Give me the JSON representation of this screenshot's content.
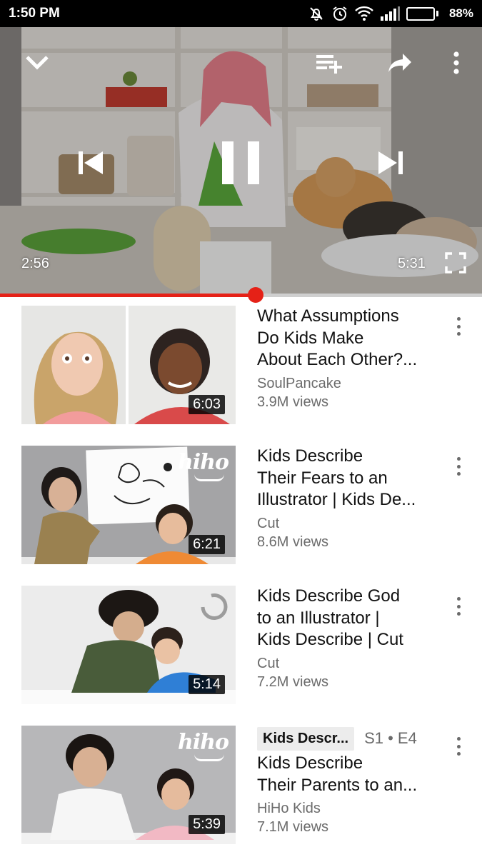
{
  "status_bar": {
    "time": "1:50 PM",
    "battery_percent": "88%",
    "battery_level": 0.88,
    "icons": [
      "mute-icon",
      "alarm-icon",
      "wifi-icon",
      "signal-icon",
      "battery-icon"
    ]
  },
  "player": {
    "current_time": "2:56",
    "total_time": "5:31",
    "progress": 0.53,
    "controls": [
      "collapse-chevron-icon",
      "add-to-queue-icon",
      "share-icon",
      "more-vert-icon",
      "previous-icon",
      "pause-icon",
      "next-icon",
      "fullscreen-icon"
    ]
  },
  "colors": {
    "accent_red": "#e52117",
    "secondary_text": "#6b6b6b",
    "chip_background": "#ececec"
  },
  "videos": [
    {
      "title_line1": "What Assumptions",
      "title_line2": "Do Kids Make",
      "title_line3": "About Each Other?...",
      "channel": "SoulPancake",
      "views": "3.9M views",
      "duration": "6:03"
    },
    {
      "title_line1": "Kids Describe",
      "title_line2": "Their Fears to an",
      "title_line3": "Illustrator | Kids De...",
      "channel": "Cut",
      "views": "8.6M views",
      "duration": "6:21",
      "thumb_logo": "hiho"
    },
    {
      "title_line1": "Kids Describe God",
      "title_line2": "to an Illustrator |",
      "title_line3": "Kids Describe | Cut",
      "channel": "Cut",
      "views": "7.2M views",
      "duration": "5:14"
    },
    {
      "series_chip": "Kids Descr...",
      "series_episode": "S1 • E4",
      "title_line1": "Kids Describe",
      "title_line2": "Their Parents to an...",
      "channel": "HiHo Kids",
      "views": "7.1M views",
      "duration": "5:39",
      "thumb_logo": "hiho"
    }
  ]
}
